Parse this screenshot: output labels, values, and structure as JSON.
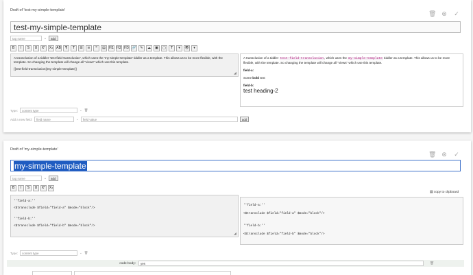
{
  "card1": {
    "draft_title": "Draft of 'test-my-simple-template'",
    "title": "test-my-simple-template",
    "tag_placeholder": "tag name",
    "add_label": "add",
    "toolbar": [
      "B",
      "I",
      "S",
      "U",
      "X²",
      "X₂",
      "AB",
      "¶",
      "T",
      "☰",
      "≡",
      "❝",
      "▤",
      "H1",
      "H2",
      "H3",
      "🔗",
      "✎",
      "☁",
      "▣",
      "▢",
      "T",
      "▾",
      "👁",
      "▾"
    ],
    "editor_lines": [
      "A transclusion of a tiddler 'test-field-transclusion', which uses the 'my-simple-template' tiddler as a template. This allows us to be more flexible, with the template. So changing the template will change all \"views\" which use this template.",
      "{{test-field-transclusion||my-simple-template}}"
    ],
    "preview": {
      "intro_a": "A transclusion of a tiddler",
      "code1": "test-field-transclusion",
      "intro_b": ", which uses the",
      "code2": "my-simple-template",
      "intro_c": "tiddler as a template. This allows us to be more flexible, with the template. So changing the template will change all \"views\" which use this template.",
      "field_a_label": "field-a:",
      "field_a_pre": "Some",
      "field_a_bold": "bold",
      "field_a_post": "text",
      "field_b_label": "field-b:",
      "heading": "test heading-2"
    },
    "type_label": "Type:",
    "type_placeholder": "content type",
    "new_field_label": "Add a new field:",
    "field_name_placeholder": "field name",
    "field_value_placeholder": "field value",
    "add_field_label": "add"
  },
  "card2": {
    "draft_title": "Draft of 'my-simple-template'",
    "title": "my-simple-template",
    "tag_placeholder": "tag name",
    "add_label": "add",
    "copy_label": "copy to clipboard",
    "editor_lines": [
      "''field-a:''",
      "<$transclude $field=\"field-a\" $mode=\"block\"/>",
      "''field-b:''",
      "<$transclude $field=\"field-b\" $mode=\"block\"/>"
    ],
    "preview_lines": [
      "''field-a:''",
      "<$transclude $field=\"field-a\" $mode=\"block\"/>",
      "''field-b:''",
      "<$transclude $field=\"field-b\" $mode=\"block\"/>"
    ],
    "type_label": "Type:",
    "type_placeholder": "content type",
    "codebody_label": "code-body:",
    "codebody_value": "yes"
  }
}
